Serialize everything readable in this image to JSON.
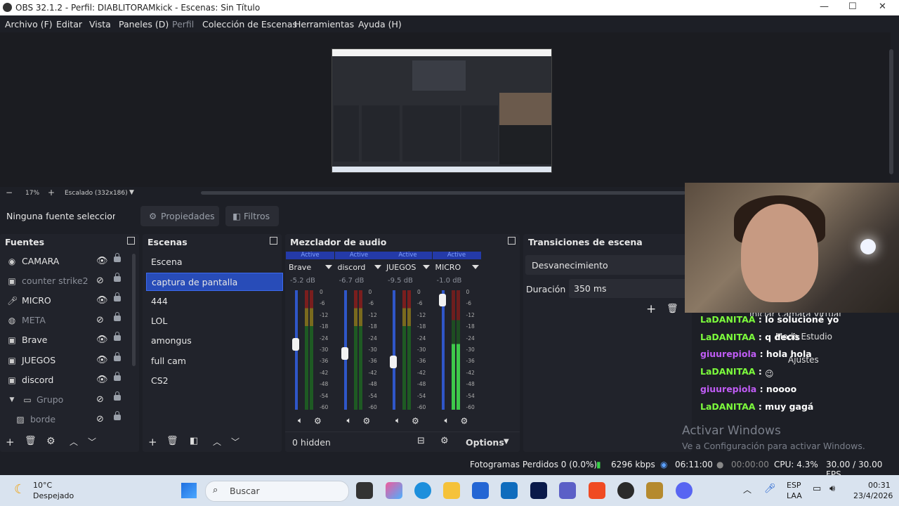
{
  "window": {
    "title": "OBS 32.1.2 - Perfil: DIABLITORAMkick - Escenas: Sin Título"
  },
  "menu": [
    "Archivo (F)",
    "Editar",
    "Vista",
    "Paneles (D)",
    "Perfil",
    "Colección de Escenas",
    "Herramientas",
    "Ayuda (H)"
  ],
  "zoom": {
    "percent": "17%",
    "mode": "Escalado (332x186)"
  },
  "source_toolbar": {
    "status": "Ninguna fuente seleccionad",
    "properties": "Propiedades",
    "filters": "Filtros"
  },
  "sources": {
    "title": "Fuentes",
    "items": [
      {
        "name": "CAMARA",
        "icon": "camera-icon",
        "visible": true
      },
      {
        "name": "counter strike2",
        "icon": "window-icon",
        "visible": false
      },
      {
        "name": "MICRO",
        "icon": "microphone-icon",
        "visible": true
      },
      {
        "name": "META",
        "icon": "browser-icon",
        "visible": false
      },
      {
        "name": "Brave",
        "icon": "window-icon",
        "visible": true
      },
      {
        "name": "JUEGOS",
        "icon": "window-icon",
        "visible": true
      },
      {
        "name": "discord",
        "icon": "window-icon",
        "visible": true
      },
      {
        "name": "Grupo",
        "icon": "folder-icon",
        "visible": false
      },
      {
        "name": "borde",
        "icon": "image-icon",
        "visible": false
      }
    ]
  },
  "scenes": {
    "title": "Escenas",
    "items": [
      "Escena",
      "captura de pantalla",
      "444",
      "LOL",
      "amongus",
      "full cam",
      "CS2"
    ],
    "selected": "captura de pantalla"
  },
  "mixer": {
    "title": "Mezclador de audio",
    "channels": [
      {
        "status": "Active",
        "name": "Brave",
        "db": "-5.2 dB",
        "fader": 0.55,
        "level": 0.9
      },
      {
        "status": "Active",
        "name": "discord",
        "db": "-6.7 dB",
        "fader": 0.47,
        "level": 0.9
      },
      {
        "status": "Active",
        "name": "JUEGOS",
        "db": "-9.5 dB",
        "fader": 0.4,
        "level": 0.9
      },
      {
        "status": "Active",
        "name": "MICRO",
        "db": "-1.0 dB",
        "fader": 0.92,
        "level": 0.6
      }
    ],
    "scale": [
      "0",
      "-6",
      "-12",
      "-18",
      "-24",
      "-30",
      "-36",
      "-42",
      "-48",
      "-54",
      "-60"
    ],
    "hidden": "0 hidden",
    "options": "Options"
  },
  "transitions": {
    "title": "Transiciones de escena",
    "type": "Desvanecimiento",
    "duration_label": "Duración",
    "duration_value": "350 ms"
  },
  "controls_partial": {
    "virtual_cam": "Iniciar Cámara Virtual",
    "studio": "Modo Estudio",
    "settings": "Ajustes"
  },
  "chat": [
    {
      "user": "LaDANITAA",
      "msg": "lo solucioné yo",
      "color": "#7cfc3c"
    },
    {
      "user": "LaDANITAA",
      "msg": "q decís",
      "color": "#7cfc3c"
    },
    {
      "user": "giuurepiola",
      "msg": "hola hola",
      "color": "#c05cf5"
    },
    {
      "user": "LaDANITAA",
      "msg": "",
      "color": "#7cfc3c"
    },
    {
      "user": "giuurepiola",
      "msg": "noooo",
      "color": "#c05cf5"
    },
    {
      "user": "LaDANITAA",
      "msg": "muy gagá",
      "color": "#7cfc3c"
    }
  ],
  "watermark": {
    "line1": "Activar Windows",
    "line2": "Ve a Configuración para activar Windows."
  },
  "status": {
    "dropped": "Fotogramas Perdidos 0 (0.0%)",
    "bitrate": "6296 kbps",
    "stream_time": "06:11:00",
    "rec_time": "00:00:00",
    "cpu": "CPU: 4.3%",
    "fps": "30.00 / 30.00 FPS"
  },
  "taskbar": {
    "weather_temp": "10°C",
    "weather_desc": "Despejado",
    "search": "Buscar",
    "lang1": "ESP",
    "lang2": "LAA",
    "time": "00:31",
    "date": "23/4/2026"
  }
}
